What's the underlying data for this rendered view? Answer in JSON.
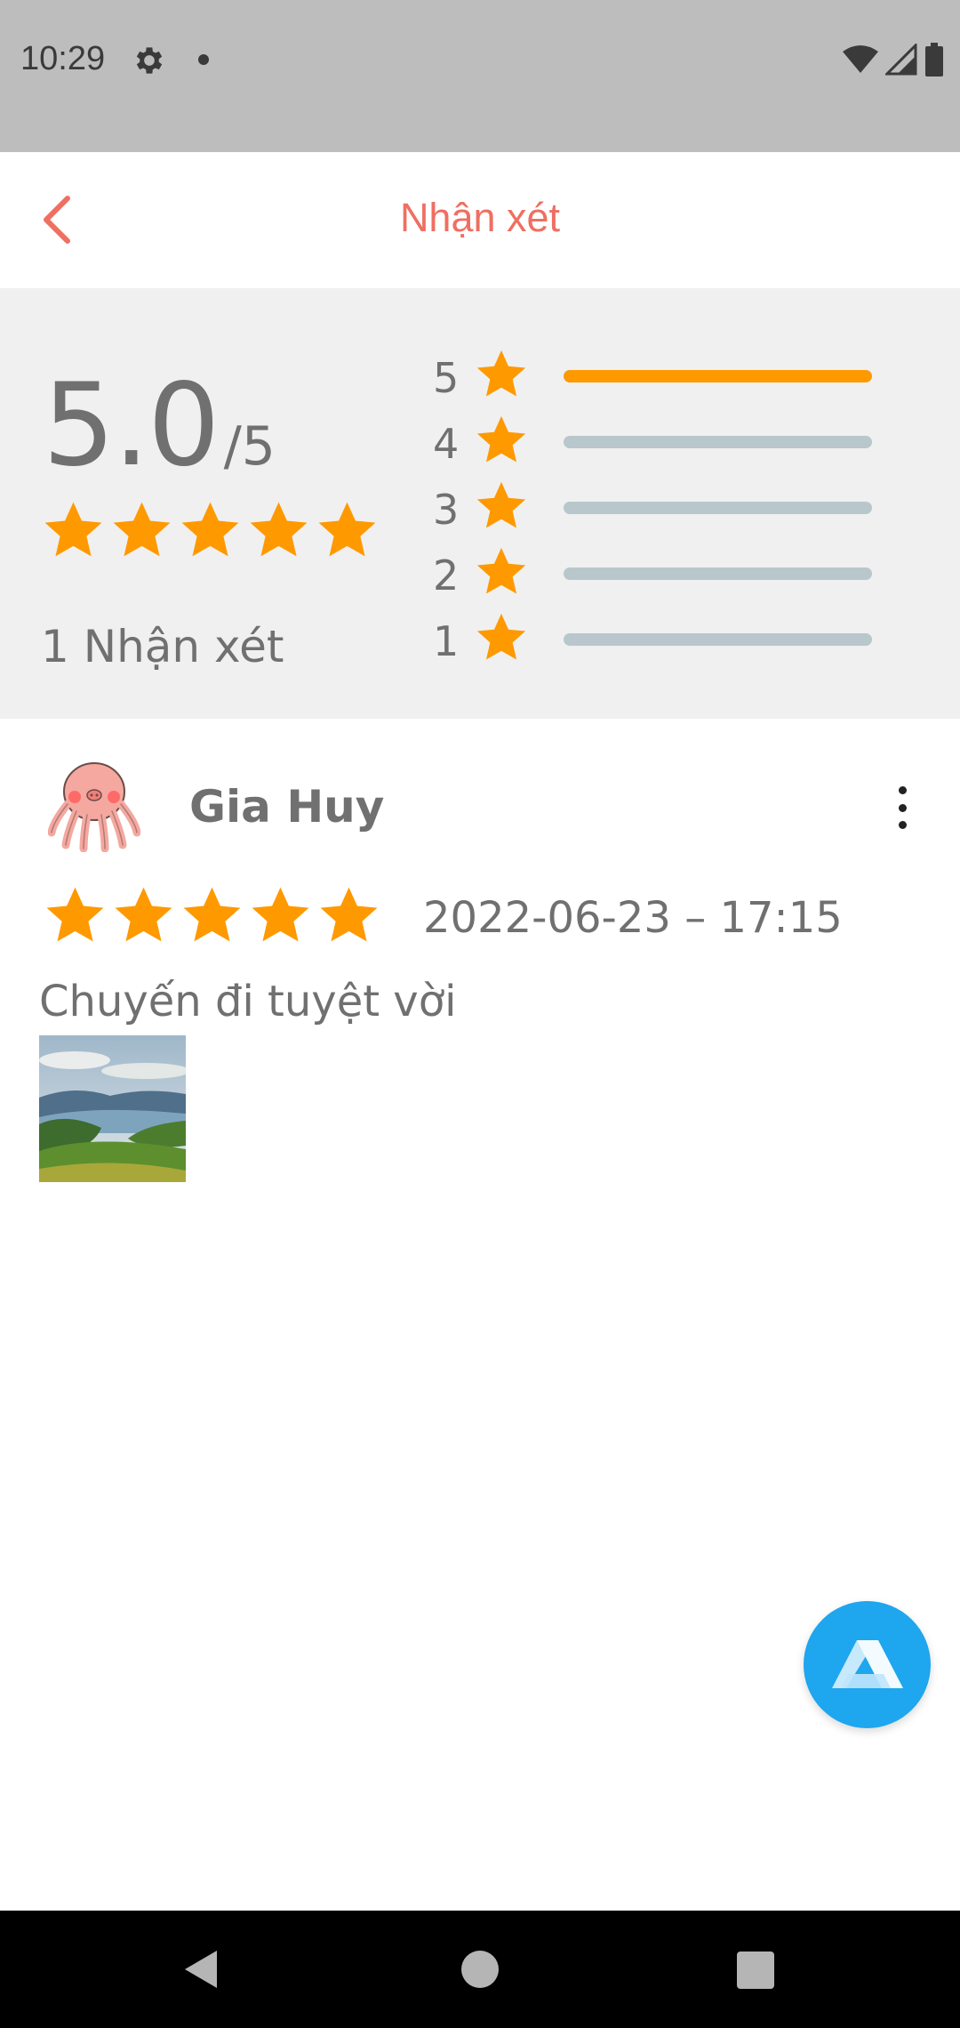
{
  "status_bar": {
    "time": "10:29",
    "icons": [
      "gear-icon",
      "notification-dot-icon",
      "wifi-icon",
      "signal-icon",
      "battery-icon"
    ]
  },
  "header": {
    "title": "Nhận xét",
    "back_icon": "chevron-left-icon",
    "accent_color": "#ef6f62"
  },
  "summary": {
    "average": "5.0",
    "max": "/5",
    "average_stars": 5,
    "count_label": "1 Nhận xét",
    "breakdown": [
      {
        "stars": "5",
        "fraction": 1.0
      },
      {
        "stars": "4",
        "fraction": 0.0
      },
      {
        "stars": "3",
        "fraction": 0.0
      },
      {
        "stars": "2",
        "fraction": 0.0
      },
      {
        "stars": "1",
        "fraction": 0.0
      }
    ],
    "star_color": "#ff9900",
    "track_color": "#b8c7cc"
  },
  "reviews": [
    {
      "author": "Gia Huy",
      "avatar_icon": "octopus-avatar-icon",
      "rating": 5,
      "date": "2022-06-23 – 17:15",
      "text": "Chuyến đi tuyệt vời",
      "photo": "landscape-photo"
    }
  ],
  "fab": {
    "icon": "app-logo-icon",
    "color": "#1ea6ee"
  },
  "nav_bar": {
    "icons": [
      "back-triangle-icon",
      "home-circle-icon",
      "recents-square-icon"
    ]
  }
}
